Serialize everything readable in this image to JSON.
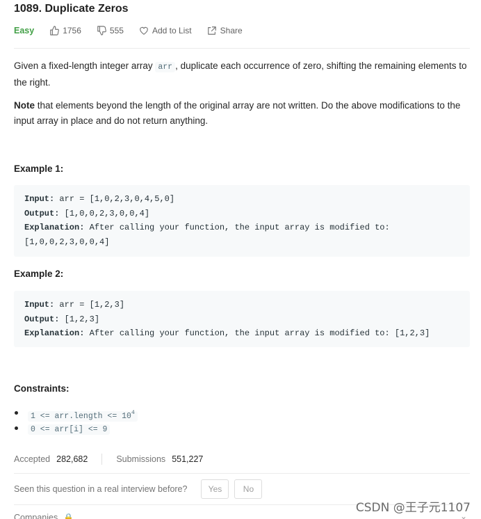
{
  "problem": {
    "title": "1089. Duplicate Zeros",
    "difficulty": "Easy",
    "likes": "1756",
    "dislikes": "555",
    "add_to_list": "Add to List",
    "share": "Share"
  },
  "description": {
    "p1_before": "Given a fixed-length integer array ",
    "p1_code": "arr",
    "p1_after": ", duplicate each occurrence of zero, shifting the remaining elements to the right.",
    "p2_bold": "Note",
    "p2_rest": " that elements beyond the length of the original array are not written. Do the above modifications to the input array in place and do not return anything."
  },
  "examples": [
    {
      "heading": "Example 1:",
      "input_label": "Input:",
      "input": " arr = [1,0,2,3,0,4,5,0]",
      "output_label": "Output:",
      "output": " [1,0,0,2,3,0,0,4]",
      "explanation_label": "Explanation:",
      "explanation_line1": " After calling your function, the input array is modified to:",
      "explanation_line2": "[1,0,0,2,3,0,0,4]"
    },
    {
      "heading": "Example 2:",
      "input_label": "Input:",
      "input": " arr = [1,2,3]",
      "output_label": "Output:",
      "output": " [1,2,3]",
      "explanation_label": "Explanation:",
      "explanation_line1": " After calling your function, the input array is modified to: [1,2,3]"
    }
  ],
  "constraints": {
    "heading": "Constraints:",
    "items": [
      {
        "base": "1 <= arr.length <= 10",
        "sup": "4"
      },
      {
        "base": "0 <= arr[i] <= 9"
      }
    ]
  },
  "stats": {
    "accepted_label": "Accepted",
    "accepted_value": "282,682",
    "submissions_label": "Submissions",
    "submissions_value": "551,227"
  },
  "interview": {
    "question": "Seen this question in a real interview before?",
    "yes": "Yes",
    "no": "No"
  },
  "companies": {
    "label": "Companies",
    "icon": "lock-icon"
  },
  "watermark": "CSDN @王子元1107",
  "colors": {
    "easy": "#43a047",
    "code_bg": "#f7f9fa",
    "accent": "#ffa116"
  }
}
